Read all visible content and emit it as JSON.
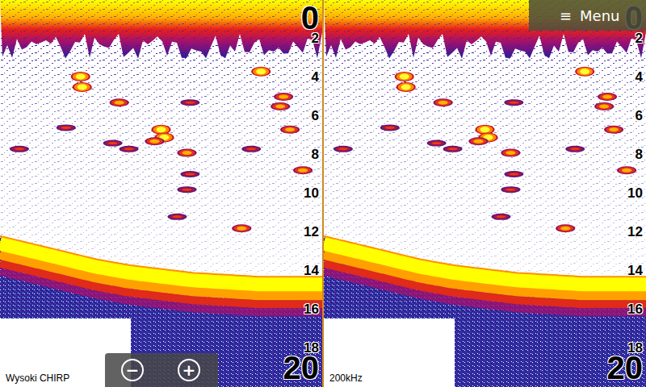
{
  "panels": [
    {
      "label": "Wysoki CHIRP",
      "zoom": {
        "out": "−",
        "in": "+"
      }
    },
    {
      "label": "200kHz",
      "menu": {
        "icon": "≡",
        "label": "Menu"
      }
    }
  ],
  "scale": {
    "top": "0",
    "ticks": [
      "2",
      "4",
      "6",
      "8",
      "10",
      "12",
      "14",
      "16",
      "18"
    ],
    "bottom": "20",
    "max_depth": 20
  },
  "sonar": {
    "surface_clutter_depth": 2.5,
    "bottom_depth": [
      12.2,
      12.6,
      13.0,
      13.4,
      13.7,
      13.9,
      14.1,
      14.2,
      14.3,
      14.3,
      14.3
    ],
    "targets": [
      {
        "ping": 25,
        "depth": 3.96,
        "strength": 1
      },
      {
        "ping": 25.5,
        "depth": 4.5,
        "strength": 1
      },
      {
        "ping": 37,
        "depth": 5.3,
        "strength": 0.7
      },
      {
        "ping": 50,
        "depth": 6.7,
        "strength": 0.9
      },
      {
        "ping": 51,
        "depth": 7.1,
        "strength": 1
      },
      {
        "ping": 48,
        "depth": 7.3,
        "strength": 0.8
      },
      {
        "ping": 58,
        "depth": 7.9,
        "strength": 0.6
      },
      {
        "ping": 81,
        "depth": 3.7,
        "strength": 1
      },
      {
        "ping": 88,
        "depth": 5.0,
        "strength": 0.8
      },
      {
        "ping": 87,
        "depth": 5.5,
        "strength": 0.8
      },
      {
        "ping": 90,
        "depth": 6.7,
        "strength": 0.6
      },
      {
        "ping": 6,
        "depth": 7.7,
        "strength": 0.5
      },
      {
        "ping": 35,
        "depth": 7.4,
        "strength": 0.5
      },
      {
        "ping": 78,
        "depth": 7.7,
        "strength": 0.5
      },
      {
        "ping": 59,
        "depth": 9.0,
        "strength": 0.4
      },
      {
        "ping": 58,
        "depth": 9.8,
        "strength": 0.5
      },
      {
        "ping": 55,
        "depth": 11.2,
        "strength": 0.4
      },
      {
        "ping": 75,
        "depth": 11.8,
        "strength": 0.6
      },
      {
        "ping": 94,
        "depth": 8.8,
        "strength": 0.7
      },
      {
        "ping": 20.5,
        "depth": 6.6,
        "strength": 0.4
      },
      {
        "ping": 59,
        "depth": 5.3,
        "strength": 0.5
      },
      {
        "ping": 40,
        "depth": 7.7,
        "strength": 0.4
      }
    ]
  }
}
